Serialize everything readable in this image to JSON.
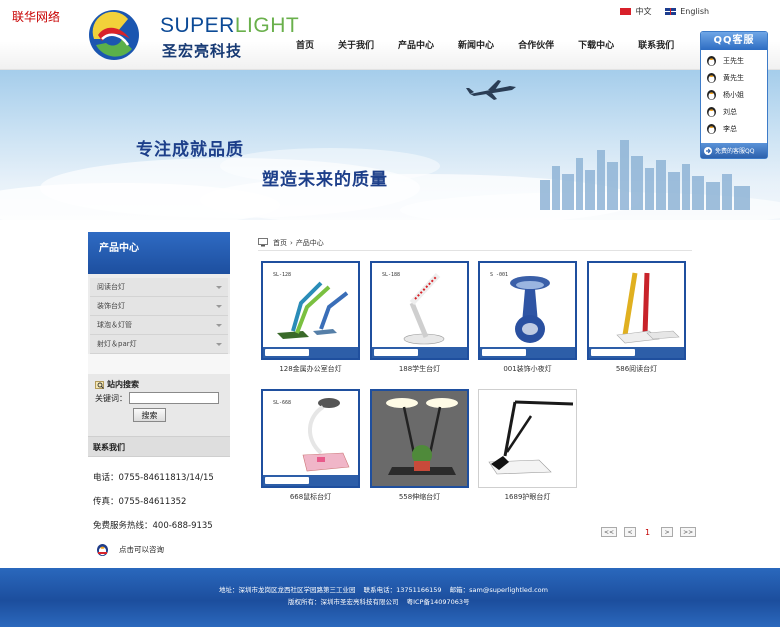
{
  "site": {
    "watermark": "联华网络",
    "logo_en_part1": "SUPER",
    "logo_en_part2": "LIGHT",
    "logo_cn": "圣宏亮科技",
    "lang_cn": "中文",
    "lang_en": "English"
  },
  "nav": [
    "首页",
    "关于我们",
    "产品中心",
    "新闻中心",
    "合作伙伴",
    "下载中心",
    "联系我们"
  ],
  "qq": {
    "title": "QQ客服",
    "agents": [
      "王先生",
      "黄先生",
      "杨小姐",
      "刘总",
      "李总"
    ],
    "footer": "免费的客服QQ"
  },
  "banner": {
    "slogan1": "专注成就品质",
    "slogan2": "塑造未来的质量"
  },
  "sidebar": {
    "title": "产品中心",
    "categories": [
      "阅读台灯",
      "装饰台灯",
      "球泡＆灯管",
      "射灯＆par灯"
    ],
    "search_title": "站内搜索",
    "search_label": "关键词：",
    "search_value": "",
    "search_button": "搜索",
    "contact_title": "联系我们",
    "phone": "电话：0755-84611813/14/15",
    "fax": "传真：0755-84611352",
    "hotline": "免费服务热线：400-688-9135",
    "consult": "点击可以咨询"
  },
  "breadcrumb": {
    "home": "首页",
    "separator": "›",
    "current": "产品中心"
  },
  "products": [
    {
      "name": "128金属办公室台灯",
      "code": "SL-128"
    },
    {
      "name": "188学生台灯",
      "code": "SL-188"
    },
    {
      "name": "001装饰小夜灯",
      "code": "S -001"
    },
    {
      "name": "586阅读台灯",
      "code": ""
    },
    {
      "name": "668鼠标台灯",
      "code": "SL-668"
    },
    {
      "name": "558伸缩台灯",
      "code": ""
    },
    {
      "name": "1689护眼台灯",
      "code": ""
    }
  ],
  "pager": {
    "first": "<<",
    "prev": "<",
    "current": "1",
    "next": ">",
    "last": ">>"
  },
  "footer": {
    "address": "地址：深圳市龙岗区龙西社区学园路第三工业园",
    "phone": "联系电话：13751166159",
    "email": "邮箱：sam@superlightled.com",
    "copyright": "版权所有：深圳市圣宏亮科技有限公司",
    "icp": "粤ICP备14097063号"
  },
  "colors": {
    "brand_blue": "#1d4f9f",
    "brand_green": "#6ab04c",
    "pager_current": "#c20000"
  }
}
